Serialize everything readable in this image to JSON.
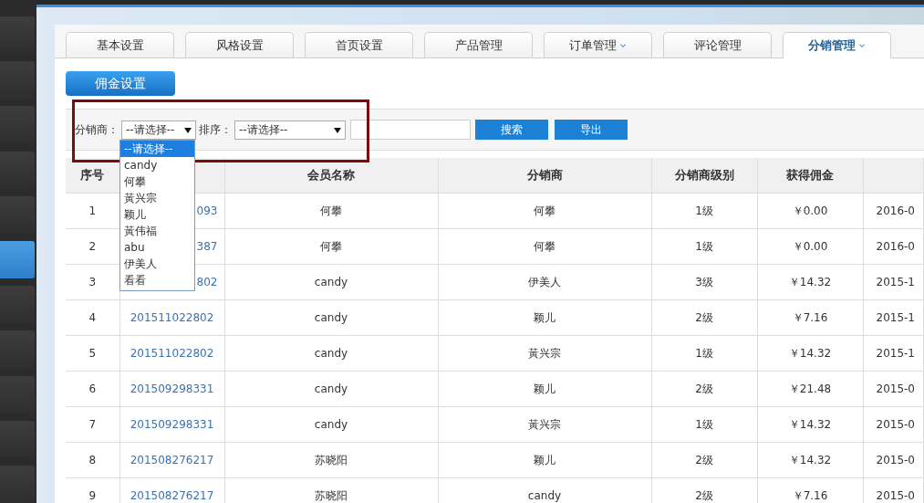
{
  "sidebar": {
    "items": [
      {
        "selected": false
      },
      {
        "selected": false
      },
      {
        "selected": false
      },
      {
        "selected": false
      },
      {
        "selected": false
      },
      {
        "selected": true
      },
      {
        "selected": false
      },
      {
        "selected": false
      },
      {
        "selected": false
      },
      {
        "selected": false
      },
      {
        "selected": false
      }
    ]
  },
  "tabs": [
    {
      "label": "基本设置",
      "selected": false,
      "has_menu": false
    },
    {
      "label": "风格设置",
      "selected": false,
      "has_menu": false
    },
    {
      "label": "首页设置",
      "selected": false,
      "has_menu": false
    },
    {
      "label": "产品管理",
      "selected": false,
      "has_menu": false
    },
    {
      "label": "订单管理",
      "selected": false,
      "has_menu": true
    },
    {
      "label": "评论管理",
      "selected": false,
      "has_menu": false
    },
    {
      "label": "分销管理",
      "selected": true,
      "has_menu": true
    }
  ],
  "primary_button": "佣金设置",
  "filters": {
    "distributor_label": "分销商：",
    "distributor_select": "--请选择--",
    "sort_label": "排序：",
    "sort_select": "--请选择--",
    "search_button": "搜索",
    "export_button": "导出"
  },
  "dropdown": {
    "options": [
      {
        "label": "--请选择--",
        "selected": true
      },
      {
        "label": "candy",
        "selected": false
      },
      {
        "label": "何攀",
        "selected": false
      },
      {
        "label": "黃兴宗",
        "selected": false
      },
      {
        "label": "颖儿",
        "selected": false
      },
      {
        "label": "黃伟福",
        "selected": false
      },
      {
        "label": "abu",
        "selected": false
      },
      {
        "label": "伊美人",
        "selected": false
      },
      {
        "label": "看看",
        "selected": false
      }
    ]
  },
  "table": {
    "columns": {
      "index": "序号",
      "member": "会员名称",
      "distributor": "分销商",
      "level": "分销商级别",
      "commission": "获得佣金"
    },
    "rows": [
      {
        "index": "1",
        "order_no": "093",
        "partial": true,
        "member": "何攀",
        "distributor": "何攀",
        "level": "1级",
        "commission": "￥0.00",
        "date": "2016-0"
      },
      {
        "index": "2",
        "order_no": "387",
        "partial": true,
        "member": "何攀",
        "distributor": "何攀",
        "level": "1级",
        "commission": "￥0.00",
        "date": "2016-0"
      },
      {
        "index": "3",
        "order_no": "802",
        "partial": true,
        "member": "candy",
        "distributor": "伊美人",
        "level": "3级",
        "commission": "￥14.32",
        "date": "2015-1"
      },
      {
        "index": "4",
        "order_no": "201511022802",
        "partial": false,
        "member": "candy",
        "distributor": "颖儿",
        "level": "2级",
        "commission": "￥7.16",
        "date": "2015-1"
      },
      {
        "index": "5",
        "order_no": "201511022802",
        "partial": false,
        "member": "candy",
        "distributor": "黃兴宗",
        "level": "1级",
        "commission": "￥14.32",
        "date": "2015-1"
      },
      {
        "index": "6",
        "order_no": "201509298331",
        "partial": false,
        "member": "candy",
        "distributor": "颖儿",
        "level": "2级",
        "commission": "￥21.48",
        "date": "2015-0"
      },
      {
        "index": "7",
        "order_no": "201509298331",
        "partial": false,
        "member": "candy",
        "distributor": "黃兴宗",
        "level": "1级",
        "commission": "￥14.32",
        "date": "2015-0"
      },
      {
        "index": "8",
        "order_no": "201508276217",
        "partial": false,
        "member": "苏晓阳",
        "distributor": "颖儿",
        "level": "2级",
        "commission": "￥14.32",
        "date": "2015-0"
      },
      {
        "index": "9",
        "order_no": "201508276217",
        "partial": false,
        "member": "苏晓阳",
        "distributor": "candy",
        "level": "2级",
        "commission": "￥7.16",
        "date": "2015-0"
      }
    ]
  }
}
